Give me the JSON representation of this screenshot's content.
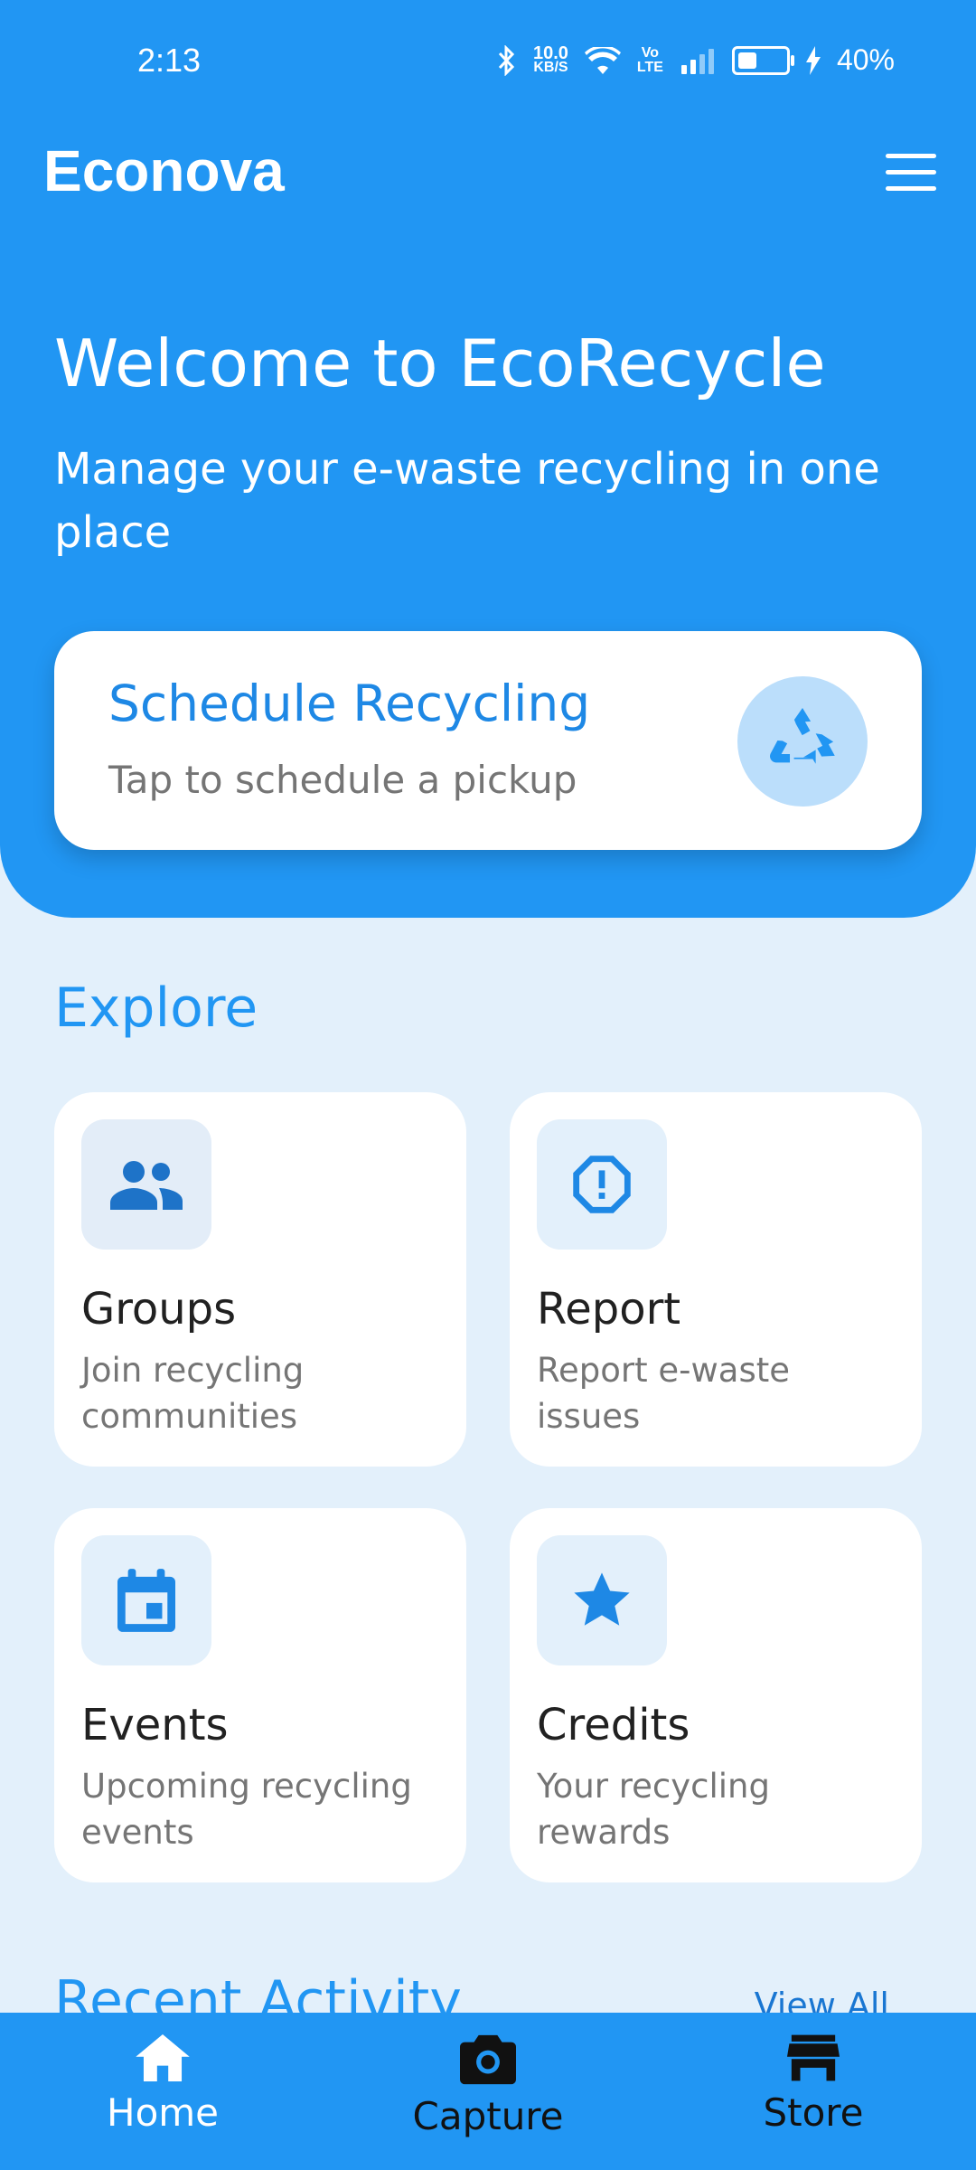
{
  "status_bar": {
    "time": "2:13",
    "net_speed_top": "10.0",
    "net_speed_bottom": "KB/S",
    "volte_top": "Vo",
    "volte_bottom": "LTE",
    "battery": "40%",
    "battery_level": 0.4
  },
  "header": {
    "app_title": "Econova",
    "menu_icon": "hamburger-menu-icon"
  },
  "hero": {
    "title": "Welcome to EcoRecycle",
    "subtitle": "Manage your e-waste recycling in one place"
  },
  "schedule_card": {
    "title": "Schedule Recycling",
    "subtitle": "Tap to schedule a pickup",
    "icon": "recycle-icon"
  },
  "explore": {
    "title": "Explore",
    "cards": [
      {
        "title": "Groups",
        "subtitle": "Join recycling communities",
        "icon": "groups-icon"
      },
      {
        "title": "Report",
        "subtitle": "Report e-waste issues",
        "icon": "report-icon"
      },
      {
        "title": "Events",
        "subtitle": "Upcoming recycling events",
        "icon": "calendar-icon"
      },
      {
        "title": "Credits",
        "subtitle": "Your recycling rewards",
        "icon": "star-icon"
      }
    ]
  },
  "recent": {
    "title": "Recent Activity",
    "view_all": "View All"
  },
  "bottom_nav": {
    "items": [
      {
        "label": "Home",
        "icon": "home-icon",
        "active": true
      },
      {
        "label": "Capture",
        "icon": "camera-icon",
        "active": false
      },
      {
        "label": "Store",
        "icon": "store-icon",
        "active": false
      }
    ]
  },
  "colors": {
    "primary": "#2196f3",
    "background": "#e3f0fb",
    "card": "#ffffff",
    "title_text": "#212121",
    "muted_text": "#757575"
  }
}
